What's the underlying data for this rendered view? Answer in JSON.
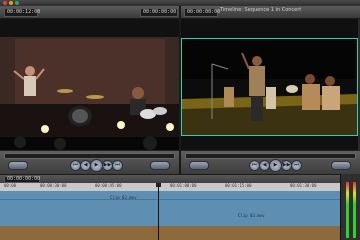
{
  "window": {
    "left_tab": "00:00:00:00",
    "right_title": "Timeline: Sequence 1 in Concert",
    "left_field": "00:00:12:00",
    "right_field": "00:00:00:00"
  },
  "viewer": {
    "left_scene": "Drummer on stage with raised sticks, drum kit lit from below",
    "right_scene": "Band performing on stage under yellow light"
  },
  "transport_buttons": [
    "⏮",
    "◀",
    "▶",
    "▶▶",
    "⏭"
  ],
  "timeline": {
    "ruler_ticks": [
      "00:00",
      "00:00:30:00",
      "00:00:45:00",
      "00:01:00:00",
      "00:01:15:00",
      "00:01:30:00"
    ],
    "video_clip_name": "Clip 02.mov",
    "video_clip_name_2": "Clip 03.mov"
  },
  "colors": {
    "video_track": "#5e8fb3",
    "audio_track": "#8c6a3e",
    "canvas_border": "#2fd0b0"
  }
}
